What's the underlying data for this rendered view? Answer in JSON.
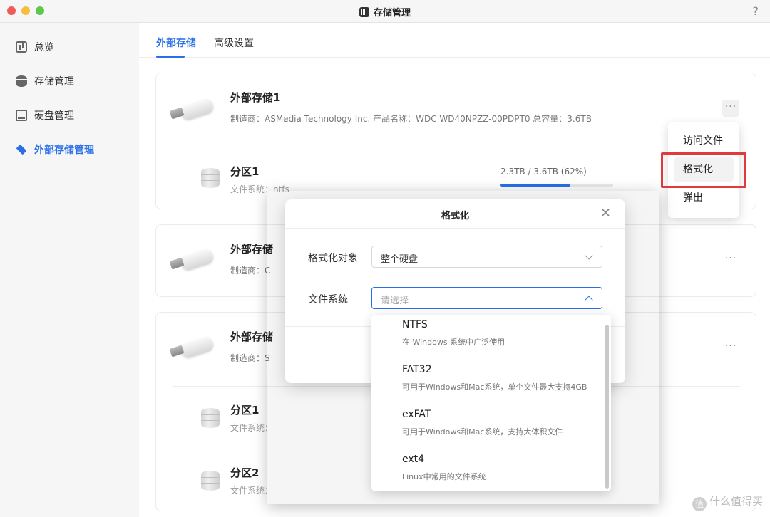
{
  "app": {
    "title": "存储管理",
    "help": "?"
  },
  "sidebar": {
    "items": [
      {
        "label": "总览",
        "icon": "chart-icon"
      },
      {
        "label": "存储管理",
        "icon": "database-icon"
      },
      {
        "label": "硬盘管理",
        "icon": "disk-icon"
      },
      {
        "label": "外部存储管理",
        "icon": "usb-icon",
        "active": true
      }
    ]
  },
  "tabs": [
    {
      "label": "外部存储",
      "active": true
    },
    {
      "label": "高级设置"
    }
  ],
  "devices": [
    {
      "name": "外部存储1",
      "meta": "制造商：ASMedia Technology Inc.    产品名称：WDC WD40NPZZ-00PDPT0    总容量：3.6TB",
      "partitions": [
        {
          "name": "分区1",
          "fs": "文件系统：ntfs",
          "usage": "2.3TB / 3.6TB (62%)",
          "usage_fraction": 0.62
        }
      ]
    },
    {
      "name": "外部存储",
      "meta": "制造商：C"
    },
    {
      "name": "外部存储",
      "meta": "制造商：S",
      "partitions": [
        {
          "name": "分区1",
          "fs": "文件系统："
        },
        {
          "name": "分区2",
          "fs": "文件系统："
        }
      ]
    }
  ],
  "more_label": "···",
  "context_menu": {
    "items": [
      "访问文件",
      "格式化",
      "弹出"
    ],
    "highlighted": "格式化"
  },
  "dialog": {
    "title": "格式化",
    "close": "✕",
    "target_label": "格式化对象",
    "target_value": "整个硬盘",
    "fs_label": "文件系统",
    "fs_placeholder": "请选择"
  },
  "fs_options": [
    {
      "name": "NTFS",
      "desc": "在 Windows 系统中广泛使用"
    },
    {
      "name": "FAT32",
      "desc": "可用于Windows和Mac系统，单个文件最大支持4GB"
    },
    {
      "name": "exFAT",
      "desc": "可用于Windows和Mac系统，支持大体积文件"
    },
    {
      "name": "ext4",
      "desc": "Linux中常用的文件系统"
    }
  ],
  "watermark": {
    "badge": "值",
    "text": "什么值得买"
  },
  "colors": {
    "accent": "#2a6ee8",
    "highlight_box": "#e0393e"
  }
}
